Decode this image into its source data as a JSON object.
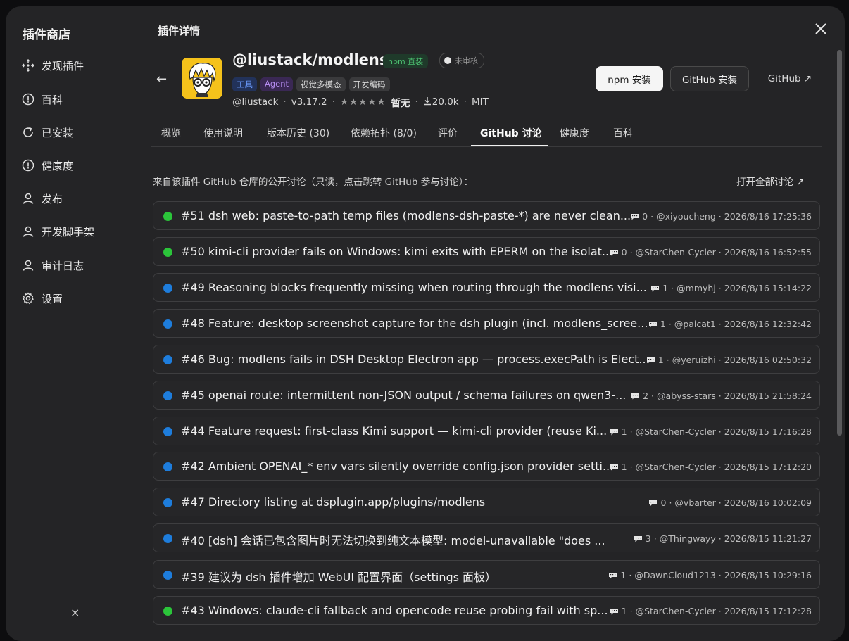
{
  "sidebar": {
    "title": "插件商店",
    "items": [
      {
        "label": "发现插件",
        "icon": "compass-icon"
      },
      {
        "label": "百科",
        "icon": "info-circle-icon"
      },
      {
        "label": "已安装",
        "icon": "refresh-icon"
      },
      {
        "label": "健康度",
        "icon": "alert-circle-icon"
      },
      {
        "label": "发布",
        "icon": "user-icon"
      },
      {
        "label": "开发脚手架",
        "icon": "user-icon"
      },
      {
        "label": "审计日志",
        "icon": "user-icon"
      },
      {
        "label": "设置",
        "icon": "gear-icon"
      }
    ],
    "collapse": "×"
  },
  "header": {
    "title": "插件详情",
    "back": "←"
  },
  "plugin": {
    "name": "@liustack/modlens",
    "npm_badge": "npm 直装",
    "review_badge": "未审核",
    "tags": [
      "工具",
      "Agent",
      "视觉多模态",
      "开发编码"
    ],
    "author": "@liustack",
    "version": "v3.17.2",
    "stars": "★★★★★",
    "rating": "暂无",
    "downloads": "20.0k",
    "license": "MIT",
    "dot": "·"
  },
  "actions": {
    "npm_install": "npm 安装",
    "github_install": "GitHub 安装",
    "github_link": "GitHub ↗"
  },
  "tabs": [
    "概览",
    "使用说明",
    "版本历史 (30)",
    "依赖拓扑 (8/0)",
    "评价",
    "GitHub 讨论",
    "健康度",
    "百科"
  ],
  "active_tab": "GitHub 讨论",
  "discussions": {
    "intro": "来自该插件 GitHub 仓库的公开讨论（只读，点击跳转 GitHub 参与讨论）：",
    "open_all": "打开全部讨论 ↗",
    "items": [
      {
        "state": "open",
        "title": "#51 dsh web: paste-to-path temp files (modlens-dsh-paste-*) are never clean...",
        "comments": "0",
        "author": "@xiyoucheng",
        "time": "2026/8/16 17:25:36"
      },
      {
        "state": "open",
        "title": "#50 kimi-cli provider fails on Windows: kimi exits with EPERM on the isolat...",
        "comments": "0",
        "author": "@StarChen-Cycler",
        "time": "2026/8/16 16:52:55"
      },
      {
        "state": "closed",
        "title": "#49 Reasoning blocks frequently missing when routing through the modlens visi...",
        "comments": "1",
        "author": "@mmyhj",
        "time": "2026/8/16 15:14:22"
      },
      {
        "state": "closed",
        "title": "#48 Feature: desktop screenshot capture for the dsh plugin (incl. modlens_scree...",
        "comments": "1",
        "author": "@paicat1",
        "time": "2026/8/16 12:32:42"
      },
      {
        "state": "closed",
        "title": "#46 Bug: modlens fails in DSH Desktop Electron app — process.execPath is Elect...",
        "comments": "1",
        "author": "@yeruizhi",
        "time": "2026/8/16 02:50:32"
      },
      {
        "state": "closed",
        "title": "#45 openai route: intermittent non-JSON output / schema failures on qwen3-...",
        "comments": "2",
        "author": "@abyss-stars",
        "time": "2026/8/15 21:58:24"
      },
      {
        "state": "closed",
        "title": "#44 Feature request: first-class Kimi support — kimi-cli provider (reuse Ki...",
        "comments": "1",
        "author": "@StarChen-Cycler",
        "time": "2026/8/15 17:16:28"
      },
      {
        "state": "closed",
        "title": "#42 Ambient OPENAI_* env vars silently override config.json provider setti...",
        "comments": "1",
        "author": "@StarChen-Cycler",
        "time": "2026/8/15 17:12:20"
      },
      {
        "state": "closed",
        "title": "#47 Directory listing at dsplugin.app/plugins/modlens",
        "comments": "0",
        "author": "@vbarter",
        "time": "2026/8/16 10:02:09"
      },
      {
        "state": "closed",
        "title": "#40 [dsh] 会话已包含图片时无法切换到纯文本模型: model-unavailable \"does ...",
        "comments": "3",
        "author": "@Thingwayy",
        "time": "2026/8/15 11:21:27"
      },
      {
        "state": "closed",
        "title": "#39 建议为 dsh 插件增加 WebUI 配置界面（settings 面板）",
        "comments": "1",
        "author": "@DawnCloud1213",
        "time": "2026/8/15 10:29:16"
      },
      {
        "state": "open",
        "title": "#43 Windows: claude-cli fallback and opencode reuse probing fail with sp...",
        "comments": "1",
        "author": "@StarChen-Cycler",
        "time": "2026/8/15 17:12:28"
      }
    ]
  },
  "colors": {
    "open": "#2bc53a",
    "closed": "#1e7ddc",
    "accent_bg": "#242426"
  }
}
